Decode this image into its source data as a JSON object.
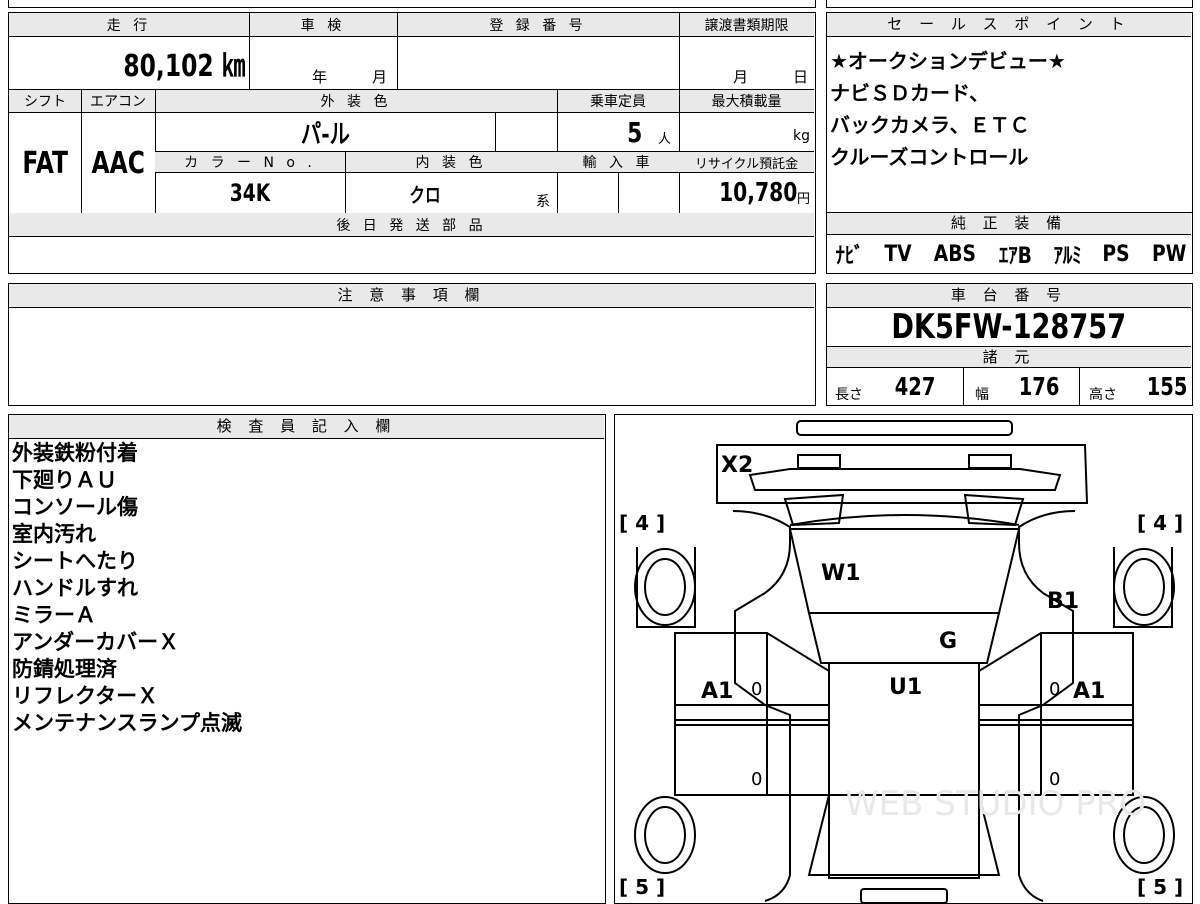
{
  "top": {
    "mileage_label": "走 行",
    "shaken_label": "車 検",
    "reg_label": "登 録 番 号",
    "transfer_label": "譲渡書類期限",
    "mileage_value": "80,102 ㎞",
    "shaken_year": "年",
    "shaken_month": "月",
    "transfer_month": "月",
    "transfer_day": "日"
  },
  "row2": {
    "shift_label": "シフト",
    "ac_label": "エアコン",
    "color_label": "外 装 色",
    "capacity_label": "乗車定員",
    "maxload_label": "最大積載量",
    "shift_value": "FAT",
    "ac_value": "AAC",
    "color_value": "パ-ル",
    "capacity_value": "5",
    "capacity_unit": "人",
    "maxload_unit": "kg",
    "colorno_label": "カ ラ ー N o .",
    "interior_label": "内 装 色",
    "import_label": "輸 入 車",
    "recycle_label": "リサイクル預託金",
    "colorno_value": "34K",
    "interior_value": "クロ",
    "interior_suffix": "系",
    "recycle_value": "10,780",
    "recycle_unit": "円"
  },
  "later_parts_label": "後 日 発 送 部 品",
  "sales_point": {
    "label": "セ ー ル ス ポ イ ン ト",
    "lines": [
      "★オークションデビュー★",
      "ナビＳＤカード、",
      "バックカメラ、ＥＴＣ",
      "クルーズコントロール"
    ]
  },
  "equipment": {
    "label": "純 正 装 備",
    "items": [
      "ﾅﾋﾞ",
      "TV",
      "ABS",
      "ｴｱB",
      "ｱﾙﾐ",
      "PS",
      "PW"
    ]
  },
  "notes_label": "注 意 事 項 欄",
  "chassis": {
    "label": "車 台 番 号",
    "value": "DK5FW-128757",
    "spec_label": "諸 元",
    "length_label": "長さ",
    "length_value": "427",
    "width_label": "幅",
    "width_value": "176",
    "height_label": "高さ",
    "height_value": "155"
  },
  "inspector": {
    "label": "検 査 員 記 入 欄",
    "notes": [
      "外装鉄粉付着",
      "下廻りＡＵ",
      "コンソール傷",
      "室内汚れ",
      "シートへたり",
      "ハンドルすれ",
      "ミラーＡ",
      "アンダーカバーＸ",
      "防錆処理済",
      "リフレクターＸ",
      "メンテナンスランプ点滅"
    ]
  },
  "diagram": {
    "marks": {
      "x2": "X2",
      "w1": "W1",
      "b1": "B1",
      "g": "G",
      "u1": "U1",
      "a1_left": "A1",
      "a1_right": "A1"
    },
    "tires": {
      "fl": "[ 4 ]",
      "fr": "[ 4 ]",
      "rl": "[ 5 ]",
      "rr": "[ 5 ]"
    },
    "zero": "0",
    "watermark": "WEB STUDIO PRO"
  }
}
